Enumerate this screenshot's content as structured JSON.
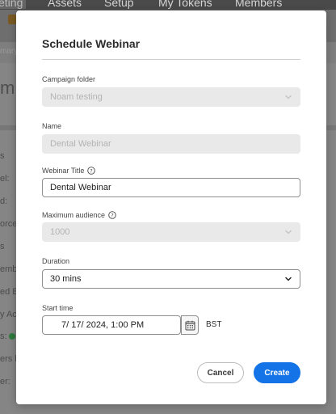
{
  "background": {
    "nav_tabs": [
      {
        "label": "eting",
        "active": true
      },
      {
        "label": "Assets"
      },
      {
        "label": "Setup"
      },
      {
        "label": "My Tokens"
      },
      {
        "label": "Members"
      }
    ],
    "breadcrumb": "mary",
    "page_heading": "m",
    "side_labels": [
      "s",
      "el:",
      "d:",
      "orce",
      "s",
      "emb",
      "ed B",
      "y Acc",
      "s:",
      "ers b",
      "er:"
    ]
  },
  "dialog": {
    "title": "Schedule Webinar",
    "campaign_folder": {
      "label": "Campaign folder",
      "value": "Noam testing",
      "disabled": true
    },
    "name": {
      "label": "Name",
      "value": "Dental Webinar",
      "disabled": true
    },
    "webinar_title": {
      "label": "Webinar Title",
      "value": "Dental Webinar"
    },
    "max_audience": {
      "label": "Maximum audience",
      "value": "1000",
      "disabled": true
    },
    "duration": {
      "label": "Duration",
      "value": "30 mins"
    },
    "start_time": {
      "label": "Start time",
      "value": "7/ 17/ 2024,   1:00 PM",
      "timezone": "BST"
    },
    "buttons": {
      "cancel": "Cancel",
      "create": "Create"
    }
  },
  "colors": {
    "primary": "#1473e6",
    "overlay": "#7e7e7e",
    "disabled_field": "#e9e9e9",
    "disabled_text": "#b3b3b3"
  }
}
